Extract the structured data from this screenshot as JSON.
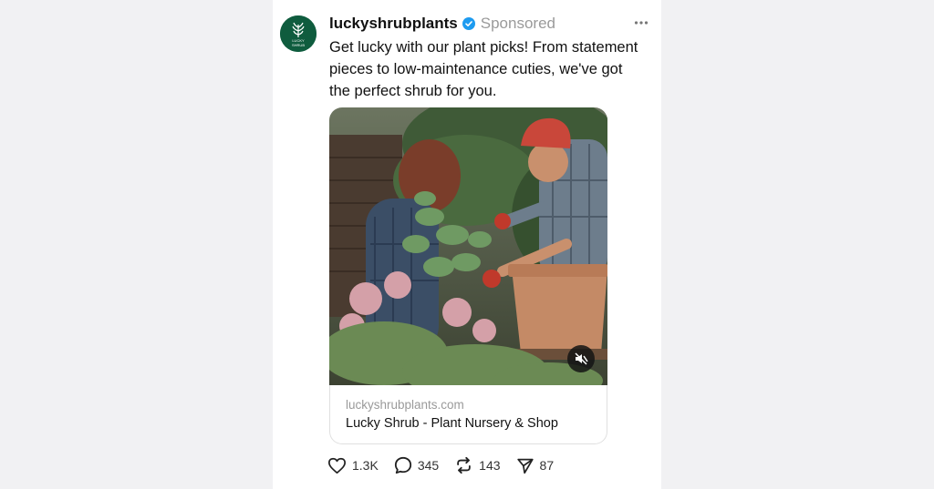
{
  "post": {
    "username": "luckyshrubplants",
    "sponsored_label": "Sponsored",
    "caption": "Get lucky with our plant picks! From statement pieces to low-maintenance cuties, we've got the perfect shrub for you.",
    "avatar_logo_text": "LUCKY SHRUB",
    "media_icon": "muted-speaker-icon"
  },
  "link_card": {
    "domain": "luckyshrubplants.com",
    "title": "Lucky Shrub - Plant Nursery & Shop"
  },
  "actions": {
    "likes": "1.3K",
    "comments": "345",
    "reposts": "143",
    "shares": "87"
  },
  "colors": {
    "brand_green": "#0f5c3e",
    "verified_blue": "#1d9bf0",
    "muted_text": "#9a9a9a"
  }
}
